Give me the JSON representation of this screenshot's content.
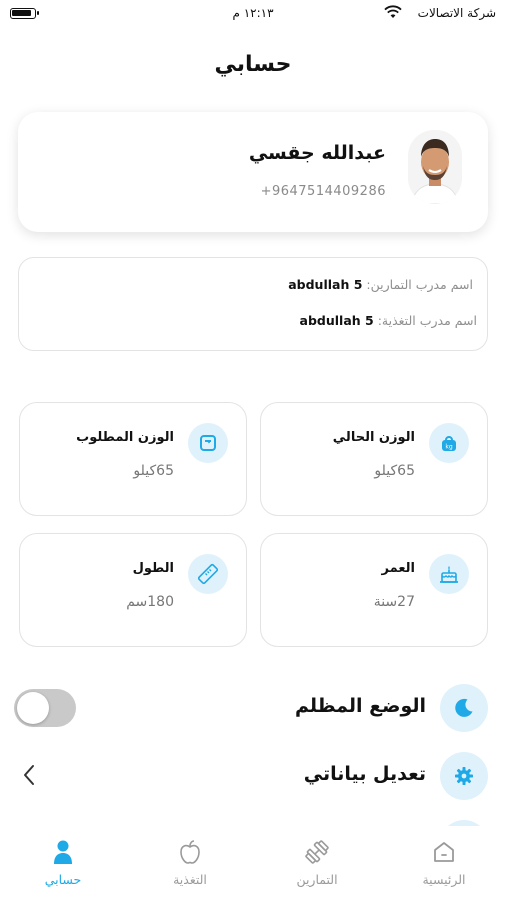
{
  "status_bar": {
    "carrier": "شركة الاتصالات",
    "time": "١٢:١٣ م"
  },
  "page": {
    "title": "حسابي"
  },
  "profile": {
    "name": "عبدالله جقسي",
    "phone": "+9647514409286"
  },
  "trainers": {
    "workout_label": "اسم مدرب التمارين:",
    "workout_value": "abdullah 5",
    "nutrition_label": "اسم مدرب التغذية:",
    "nutrition_value": "abdullah 5"
  },
  "stats": {
    "current_weight": {
      "label": "الوزن الحالي",
      "value": "65كيلو"
    },
    "target_weight": {
      "label": "الوزن المطلوب",
      "value": "65كيلو"
    },
    "age": {
      "label": "العمر",
      "value": "27سنة"
    },
    "height": {
      "label": "الطول",
      "value": "180سم"
    }
  },
  "settings": {
    "dark_mode": {
      "label": "الوضع المظلم",
      "enabled": false
    },
    "edit_data": {
      "label": "تعديل بياناتي"
    }
  },
  "tabs": [
    {
      "id": "home",
      "label": "الرئيسية",
      "icon": "home-icon"
    },
    {
      "id": "workouts",
      "label": "التمارين",
      "icon": "dumbbell-icon"
    },
    {
      "id": "nutrition",
      "label": "التغذية",
      "icon": "apple-icon"
    },
    {
      "id": "account",
      "label": "حسابي",
      "icon": "user-icon",
      "active": true
    }
  ],
  "colors": {
    "accent": "#1fa9e6",
    "icon_bg": "#dff1fb",
    "toggle_off": "#c9c9c9"
  }
}
